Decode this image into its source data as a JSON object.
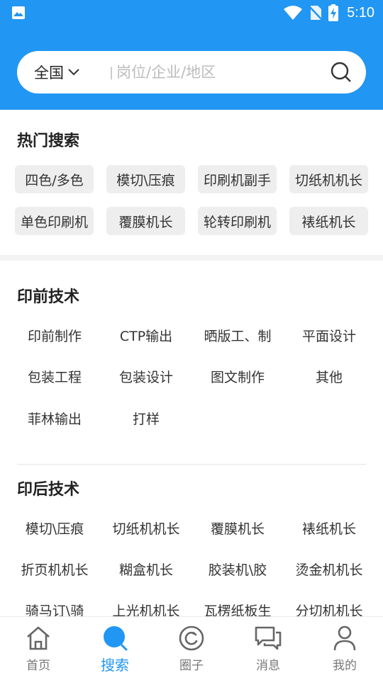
{
  "status_bar": {
    "time": "5:10"
  },
  "search": {
    "region": "全国",
    "placeholder": "岗位/企业/地区"
  },
  "hot_search": {
    "title": "热门搜索",
    "tags": [
      "四色/多色",
      "模切\\压痕",
      "印刷机副手",
      "切纸机机长",
      "单色印刷机",
      "覆膜机长",
      "轮转印刷机",
      "裱纸机长"
    ]
  },
  "prepress": {
    "title": "印前技术",
    "items": [
      "印前制作",
      "CTP输出",
      "晒版工、制",
      "平面设计",
      "包装工程",
      "包装设计",
      "图文制作",
      "其他",
      "菲林输出",
      "打样"
    ]
  },
  "postpress": {
    "title": "印后技术",
    "items": [
      "模切\\压痕",
      "切纸机机长",
      "覆膜机长",
      "裱纸机长",
      "折页机机长",
      "糊盒机长",
      "胶装机\\胶",
      "烫金机机长",
      "骑马订\\骑",
      "上光机机长",
      "瓦楞纸板生",
      "分切机机长"
    ]
  },
  "bottom_nav": [
    {
      "label": "首页",
      "icon": "home-icon",
      "active": false
    },
    {
      "label": "搜索",
      "icon": "search-icon",
      "active": true
    },
    {
      "label": "圈子",
      "icon": "circle-icon",
      "active": false
    },
    {
      "label": "消息",
      "icon": "message-icon",
      "active": false
    },
    {
      "label": "我的",
      "icon": "profile-icon",
      "active": false
    }
  ],
  "colors": {
    "primary": "#2196F3",
    "tag_bg": "#EEEEEE"
  }
}
